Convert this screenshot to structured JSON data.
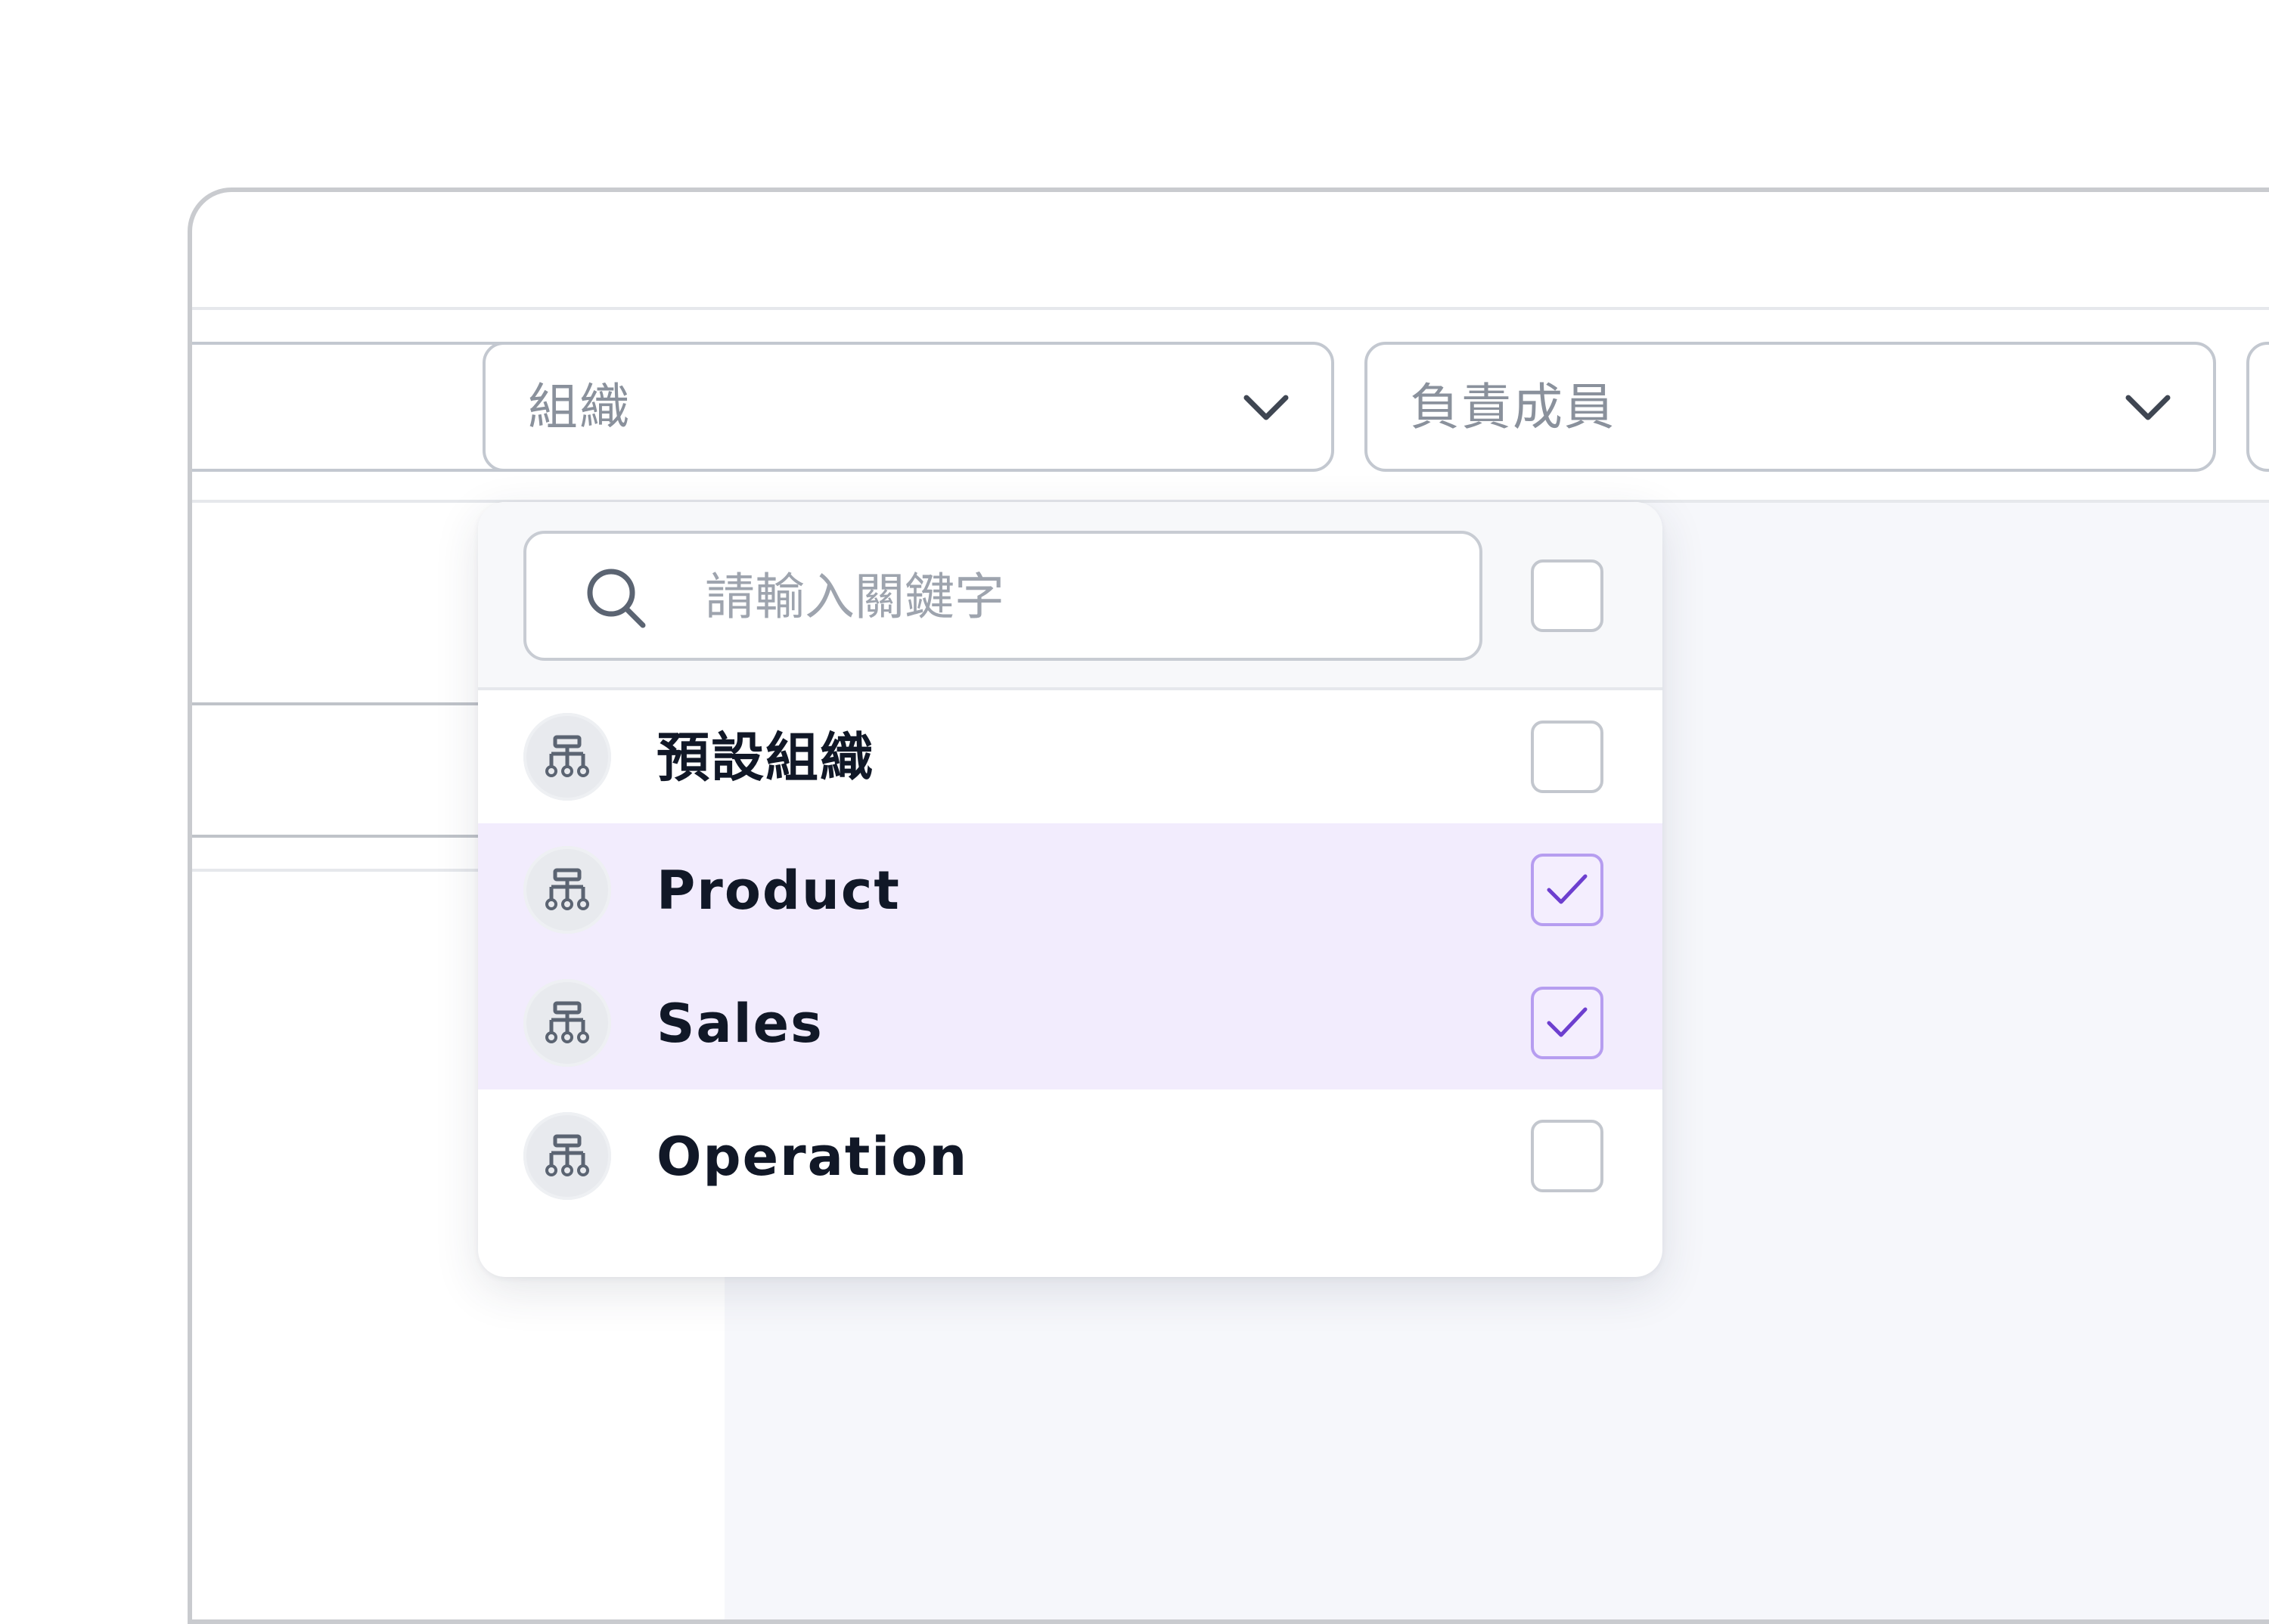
{
  "filters": {
    "org": {
      "label": "組織"
    },
    "owner": {
      "label": "負責成員"
    }
  },
  "dropdown": {
    "search_placeholder": "請輸入關鍵字",
    "options": [
      {
        "label": "預設組織",
        "checked": false
      },
      {
        "label": "Product",
        "checked": true
      },
      {
        "label": "Sales",
        "checked": true
      },
      {
        "label": "Operation",
        "checked": false
      }
    ]
  },
  "colors": {
    "accent": "#7b4fd6",
    "selected_row_bg": "#f2ecfd",
    "text_primary": "#111827",
    "text_placeholder": "#8a919c",
    "border": "#c3c8d0"
  },
  "icons": {
    "chevron": "chevron-down-icon",
    "search": "search-icon",
    "org": "org-chart-icon",
    "check": "checkmark-icon"
  }
}
